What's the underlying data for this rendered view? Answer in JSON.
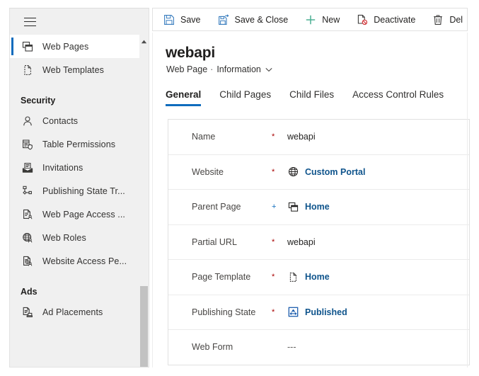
{
  "sitemap": {
    "menu_icon": "hamburger-icon",
    "items": [
      {
        "label": "Web Pages",
        "icon": "web-pages-icon",
        "selected": true,
        "type": "item"
      },
      {
        "label": "Web Templates",
        "icon": "web-template-icon",
        "selected": false,
        "type": "item"
      },
      {
        "label": "Security",
        "type": "group"
      },
      {
        "label": "Contacts",
        "icon": "contact-person-icon",
        "selected": false,
        "type": "item"
      },
      {
        "label": "Table  Permissions",
        "icon": "table-permissions-icon",
        "selected": false,
        "type": "item"
      },
      {
        "label": "Invitations",
        "icon": "invitation-envelope-icon",
        "selected": false,
        "type": "item"
      },
      {
        "label": "Publishing State Tr...",
        "icon": "publishing-state-transition-icon",
        "selected": false,
        "type": "item"
      },
      {
        "label": "Web Page Access ...",
        "icon": "web-page-access-icon",
        "selected": false,
        "type": "item"
      },
      {
        "label": "Web Roles",
        "icon": "web-roles-globe-icon",
        "selected": false,
        "type": "item"
      },
      {
        "label": "Website Access Pe...",
        "icon": "website-access-permission-icon",
        "selected": false,
        "type": "item"
      },
      {
        "label": "Ads",
        "type": "group"
      },
      {
        "label": "Ad Placements",
        "icon": "ad-placements-icon",
        "selected": false,
        "type": "item"
      }
    ],
    "accent_color": "#0f6cbd"
  },
  "command_bar": {
    "commands": [
      {
        "label": "Save",
        "icon": "save-floppy-icon"
      },
      {
        "label": "Save & Close",
        "icon": "save-and-close-icon"
      },
      {
        "label": "New",
        "icon": "plus-new-icon"
      },
      {
        "label": "Deactivate",
        "icon": "deactivate-icon"
      },
      {
        "label": "Del",
        "icon": "delete-trash-icon"
      }
    ]
  },
  "record": {
    "title": "webapi",
    "entity": "Web Page",
    "separator": "·",
    "form_name": "Information",
    "form_chevron": "chevron-down-icon"
  },
  "tabs": [
    {
      "label": "General",
      "active": true
    },
    {
      "label": "Child Pages",
      "active": false
    },
    {
      "label": "Child Files",
      "active": false
    },
    {
      "label": "Access Control Rules",
      "active": false
    }
  ],
  "form": {
    "fields": [
      {
        "label": "Name",
        "marker": "*",
        "marker_type": "required",
        "value": "webapi",
        "value_type": "text",
        "icon": ""
      },
      {
        "label": "Website",
        "marker": "*",
        "marker_type": "required",
        "value": "Custom Portal",
        "value_type": "lookup",
        "icon": "globe-icon"
      },
      {
        "label": "Parent Page",
        "marker": "+",
        "marker_type": "recommended",
        "value": "Home",
        "value_type": "lookup",
        "icon": "web-pages-icon"
      },
      {
        "label": "Partial URL",
        "marker": "*",
        "marker_type": "required",
        "value": "webapi",
        "value_type": "text",
        "icon": ""
      },
      {
        "label": "Page Template",
        "marker": "*",
        "marker_type": "required",
        "value": "Home",
        "value_type": "lookup",
        "icon": "page-template-icon"
      },
      {
        "label": "Publishing State",
        "marker": "*",
        "marker_type": "required",
        "value": "Published",
        "value_type": "lookup",
        "icon": "publishing-state-icon"
      },
      {
        "label": "Web Form",
        "marker": "",
        "marker_type": "none",
        "value": "---",
        "value_type": "empty",
        "icon": ""
      }
    ]
  },
  "colors": {
    "accent": "#0f6cbd",
    "link": "#0f548c",
    "required": "#a80000",
    "sidebar_bg": "#f0f0f0",
    "scroll_thumb": "#c2c2c2"
  },
  "scrollbar": {
    "up_arrow": "scroll-up-arrow-icon"
  }
}
